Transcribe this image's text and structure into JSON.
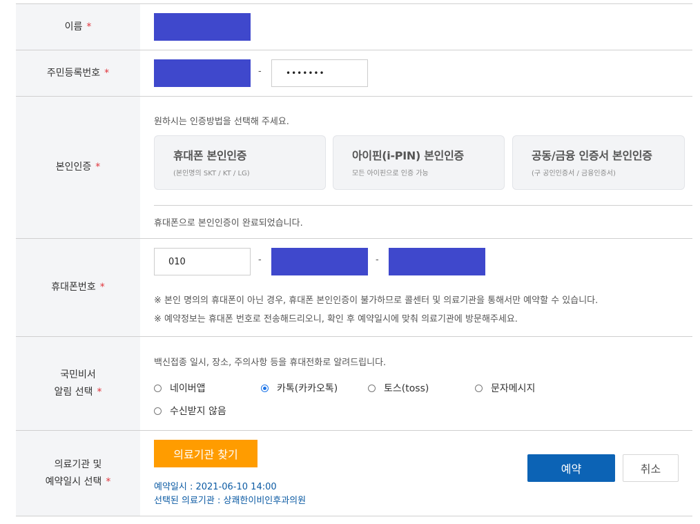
{
  "rows": {
    "name": {
      "label": "이름",
      "required": "*"
    },
    "rrn": {
      "label": "주민등록번호",
      "required": "*",
      "separator": "-",
      "back_value": "•••••••"
    },
    "auth": {
      "label": "본인인증",
      "required": "*",
      "instruction": "원하시는 인증방법을 선택해 주세요.",
      "options": [
        {
          "title": "휴대폰 본인인증",
          "sub": "(본인명의 SKT / KT / LG)"
        },
        {
          "title": "아이핀(i-PIN) 본인인증",
          "sub": "모든 아이핀으로 인증 가능"
        },
        {
          "title": "공동/금융 인증서 본인인증",
          "sub": "(구 공인인증서 / 금융인증서)"
        }
      ],
      "status": "휴대폰으로 본인인증이 완료되었습니다."
    },
    "phone": {
      "label": "휴대폰번호",
      "required": "*",
      "prefix": "010",
      "separator": "-",
      "notes": [
        "※ 본인 명의의 휴대폰이 아닌 경우, 휴대폰 본인인증이 불가하므로 콜센터 및 의료기관을 통해서만 예약할 수 있습니다.",
        "※ 예약정보는 휴대폰 번호로 전송해드리오니, 확인 후 예약일시에 맞춰 의료기관에 방문해주세요."
      ]
    },
    "notify": {
      "label_line1": "국민비서",
      "label_line2": "알림 선택",
      "required": "*",
      "instruction": "백신접종 일시, 장소, 주의사항 등을 휴대전화로 알려드립니다.",
      "options": [
        "네이버앱",
        "카톡(카카오톡)",
        "토스(toss)",
        "문자메시지",
        "수신받지 않음"
      ],
      "selected": "카톡(카카오톡)"
    },
    "hospital": {
      "label_line1": "의료기관 및",
      "label_line2": "예약일시 선택",
      "required": "*",
      "find_button": "의료기관 찾기",
      "datetime": "예약일시 : 2021-06-10 14:00",
      "selected_hospital": "선택된 의료기관 : 상쾌한이비인후과의원"
    }
  },
  "actions": {
    "submit_label": "예약",
    "cancel_label": "취소"
  },
  "colors": {
    "redaction": "#3f48cc",
    "required": "#e0333a",
    "find_button": "#ff9c00",
    "submit": "#0c63b5",
    "info_text": "#0b5aa3"
  }
}
